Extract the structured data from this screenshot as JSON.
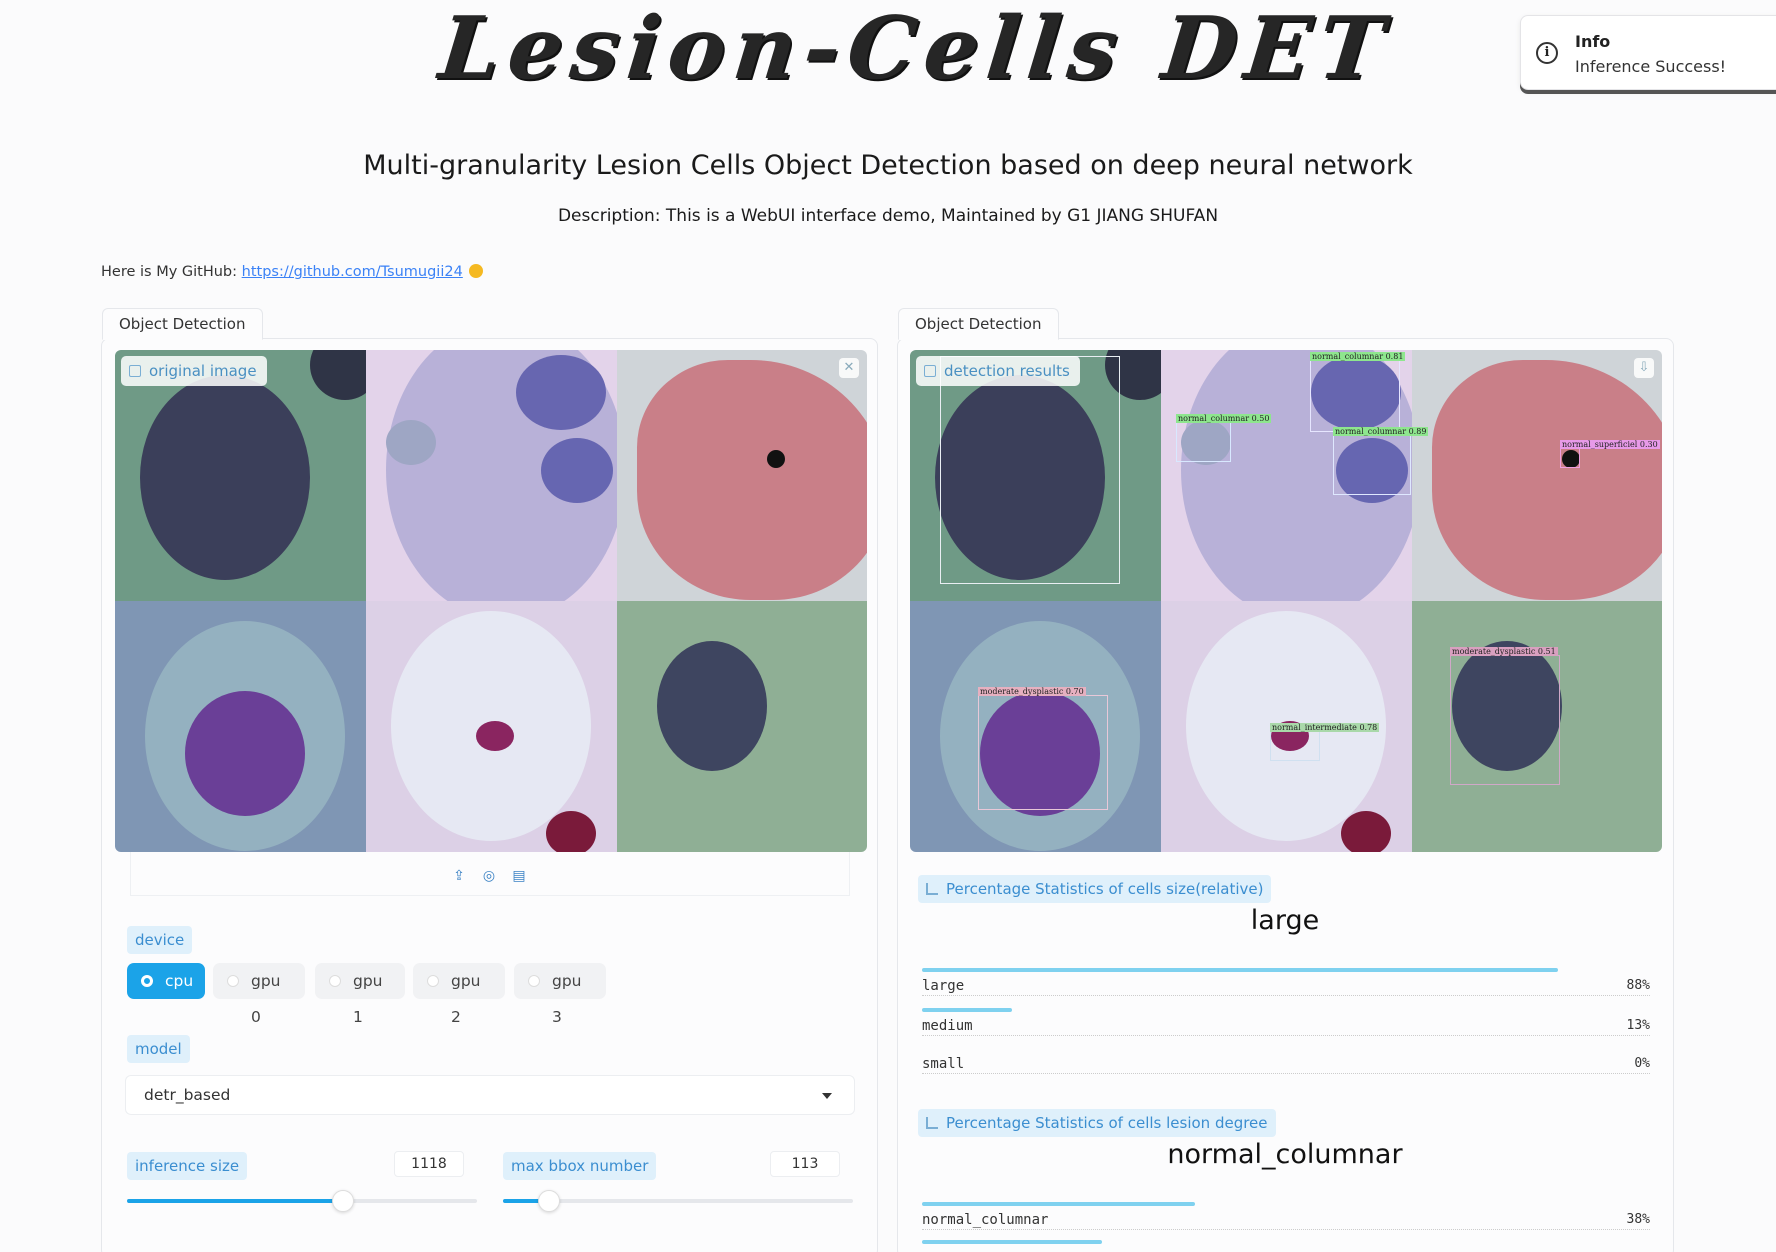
{
  "header": {
    "logo_text": "Lesion-Cells DET",
    "subtitle": "Multi-granularity Lesion Cells Object Detection based on deep neural network",
    "description": "Description: This is a WebUI interface demo, Maintained by G1 JIANG SHUFAN",
    "github_prefix": "Here is My GitHub: ",
    "github_link": "https://github.com/Tsumugii24"
  },
  "toast": {
    "title": "Info",
    "message": "Inference Success!"
  },
  "left_panel": {
    "tab_label": "Object Detection",
    "image_label": "original image",
    "device_label": "device",
    "device_options": [
      "cpu",
      "gpu 0",
      "gpu 1",
      "gpu 2",
      "gpu 3"
    ],
    "device_selected": "cpu",
    "model_label": "model",
    "model_value": "detr_based",
    "inference_size_label": "inference size",
    "inference_size_value": "1118",
    "max_bbox_label": "max bbox number",
    "max_bbox_value": "113"
  },
  "right_panel": {
    "tab_label": "Object Detection",
    "image_label": "detection results",
    "detections": [
      {
        "label": "normal_columnar 0.81"
      },
      {
        "label": "normal_columnar 0.50"
      },
      {
        "label": "normal_columnar 0.89"
      },
      {
        "label": "normal_superficiel 0.30"
      },
      {
        "label": "moderate_dysplastic 0.70"
      },
      {
        "label": "normal_intermediate 0.78"
      },
      {
        "label": "moderate_dysplastic 0.51"
      }
    ],
    "size_stats": {
      "title": "Percentage Statistics of cells size(relative)",
      "top_label": "large",
      "rows": [
        {
          "name": "large",
          "pct": "88%",
          "value": 0.88
        },
        {
          "name": "medium",
          "pct": "13%",
          "value": 0.13
        },
        {
          "name": "small",
          "pct": "0%",
          "value": 0.0
        }
      ]
    },
    "lesion_stats": {
      "title": "Percentage Statistics of cells lesion degree",
      "top_label": "normal_columnar",
      "rows": [
        {
          "name": "normal_columnar",
          "pct": "38%",
          "value": 0.38
        }
      ]
    }
  },
  "colors": {
    "accent": "#1ba3e8",
    "chip_bg": "#dff0fb",
    "chip_text": "#3b8ed0",
    "bar": "#7fd1ef"
  },
  "icons": [
    "info-icon",
    "image-icon",
    "close-icon",
    "upload-icon",
    "webcam-icon",
    "clipboard-icon",
    "download-icon",
    "chart-icon",
    "chevron-down-icon"
  ]
}
